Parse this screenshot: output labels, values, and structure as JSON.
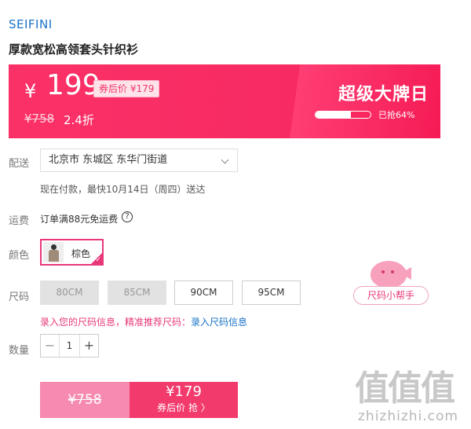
{
  "product": {
    "brand": "SEIFINI",
    "title": "厚款宽松高领套头针织衫"
  },
  "price": {
    "currency": "¥",
    "current": "199",
    "coupon_label": "券后价 ¥179",
    "original": "¥758",
    "discount": "2.4折",
    "event_title": "超级大牌日",
    "progress_fraction": 0.64,
    "progress_text": "已抢64%"
  },
  "shipping": {
    "label": "配送",
    "location": "北京市 东城区 东华门街道",
    "delivery_note": "现在付款，最快10月14日（周四）送达"
  },
  "freight": {
    "label": "运费",
    "text": "订单满88元免运费",
    "help_glyph": "?"
  },
  "color": {
    "label": "颜色",
    "selected": "棕色"
  },
  "size": {
    "label": "尺码",
    "options": [
      {
        "text": "80CM",
        "disabled": true
      },
      {
        "text": "85CM",
        "disabled": true
      },
      {
        "text": "90CM",
        "disabled": false
      },
      {
        "text": "95CM",
        "disabled": false
      }
    ],
    "helper_label": "尺码小帮手",
    "tip_text": "录入您的尺码信息，精准推荐尺码：",
    "tip_link": "录入尺码信息"
  },
  "quantity": {
    "label": "数量",
    "minus": "−",
    "value": "1",
    "plus": "+"
  },
  "buy": {
    "original": "¥758",
    "price": "¥179",
    "action": "券后价 抢 〉"
  },
  "watermark": {
    "chars": "值值值",
    "text": "zhizhizhi.com"
  },
  "colors": {
    "accent": "#f8285f",
    "link": "#1a73c8",
    "pink": "#e8387a"
  }
}
